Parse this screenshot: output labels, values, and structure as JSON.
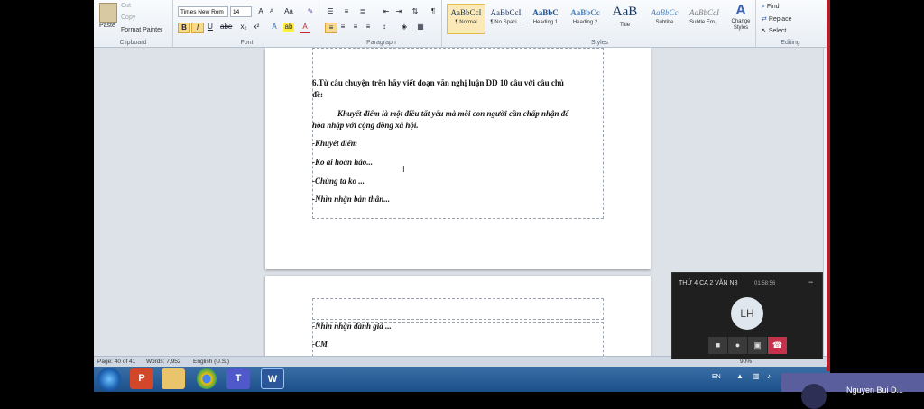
{
  "ribbon": {
    "clipboard": {
      "paste": "Paste",
      "cut": "Cut",
      "copy": "Copy",
      "format_painter": "Format Painter",
      "label": "Clipboard"
    },
    "font": {
      "font_name": "Times New Rom",
      "font_size": "14",
      "label": "Font",
      "bold": "B",
      "italic": "I",
      "underline": "U"
    },
    "paragraph": {
      "label": "Paragraph"
    },
    "styles": {
      "label": "Styles",
      "items": [
        {
          "sample": "AaBbCcI",
          "name": "¶ Normal"
        },
        {
          "sample": "AaBbCcI",
          "name": "¶ No Spaci..."
        },
        {
          "sample": "AaBbC",
          "name": "Heading 1"
        },
        {
          "sample": "AaBbCc",
          "name": "Heading 2"
        },
        {
          "sample": "AaB",
          "name": "Title"
        },
        {
          "sample": "AaBbCc",
          "name": "Subtitle"
        },
        {
          "sample": "AaBbCcI",
          "name": "Subtle Em..."
        }
      ],
      "change_styles": "Change Styles"
    },
    "editing": {
      "find": "Find",
      "replace": "Replace",
      "select": "Select",
      "label": "Editing"
    }
  },
  "document": {
    "page1": {
      "heading_line1": "6.Từ câu chuyện trên hãy viết đoạn văn nghị luận DD 10 câu với câu chủ",
      "heading_line2": "đề:",
      "quote_line1": "Khuyết điểm là một điều tất yếu mà mỗi con người cần chấp nhận để",
      "quote_line2": "hòa nhập với cộng đồng xã hội.",
      "bullets": [
        "-Khuyết  điểm",
        "-Ko ai hoàn hảo...",
        "-Chúng ta ko ...",
        "-Nhìn nhận bản thân..."
      ]
    },
    "page2": {
      "bullets": [
        "-Nhìn nhận đánh giá ...",
        "-CM"
      ]
    }
  },
  "status_bar": {
    "page": "Page: 40 of 41",
    "words": "Words: 7,952",
    "language": "English (U.S.)",
    "zoom": "90%"
  },
  "taskbar": {
    "lang": "EN"
  },
  "call": {
    "title": "THỨ 4 CA 2 VĂN N3",
    "timer": "01:58:56",
    "avatar": "LH",
    "minimize": "−"
  },
  "presenter": {
    "name": "Nguyen Bui D..."
  }
}
